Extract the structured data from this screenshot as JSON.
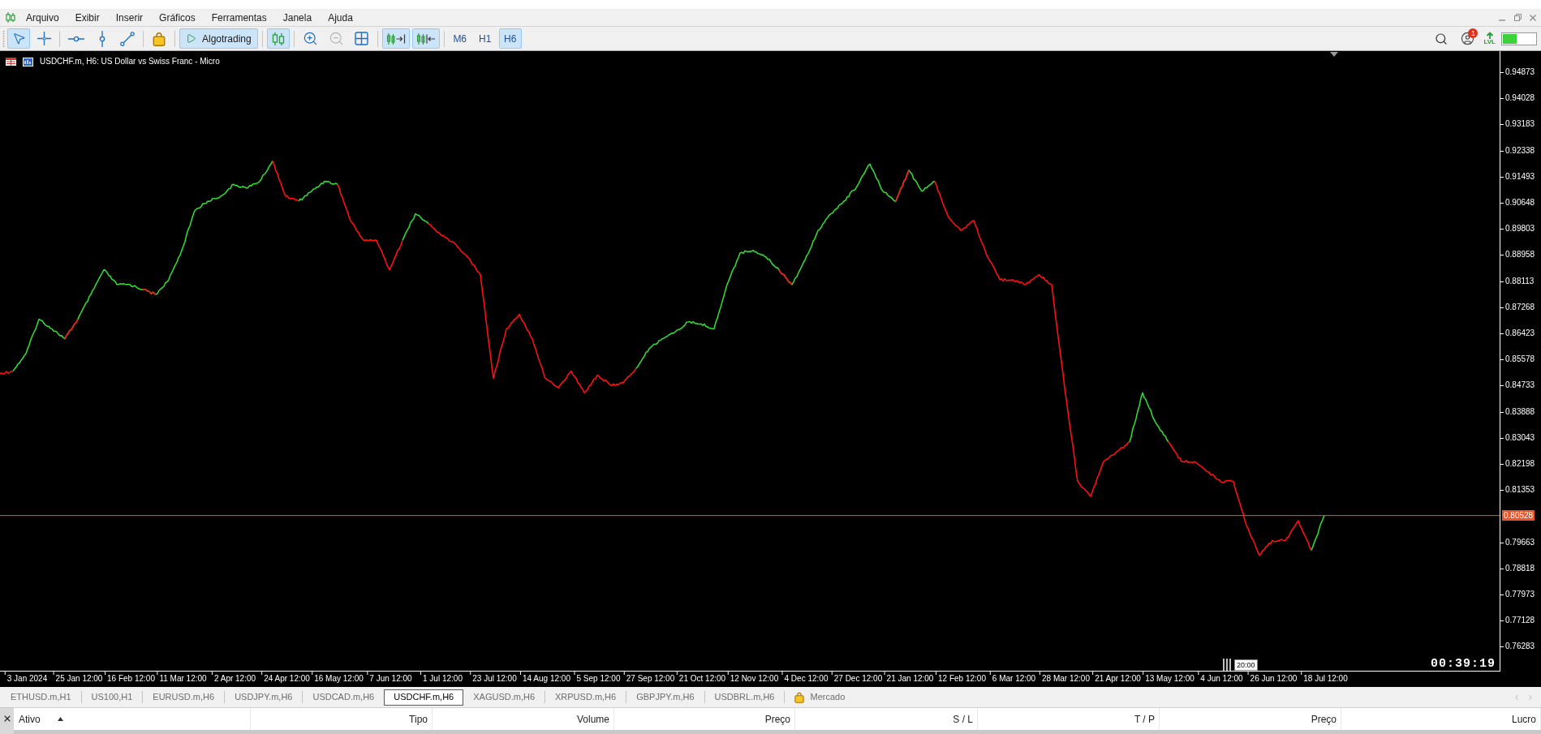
{
  "menu_bar": {
    "items": [
      "Arquivo",
      "Exibir",
      "Inserir",
      "Gráficos",
      "Ferramentas",
      "Janela",
      "Ajuda"
    ]
  },
  "toolbar": {
    "groups": [
      {
        "buttons": [
          {
            "kind": "cursor",
            "selected": true,
            "disabled": false
          },
          {
            "kind": "crosshair",
            "selected": false,
            "disabled": false
          }
        ]
      },
      {
        "buttons": [
          {
            "kind": "hline",
            "selected": false,
            "disabled": false
          },
          {
            "kind": "vline",
            "selected": false,
            "disabled": false
          },
          {
            "kind": "trendline",
            "selected": false,
            "disabled": false
          }
        ]
      },
      {
        "buttons": [
          {
            "kind": "market",
            "selected": false,
            "disabled": false
          }
        ]
      },
      {
        "buttons": [
          {
            "kind": "algotrading",
            "label": "Algotrading",
            "selected": true,
            "disabled": false
          }
        ]
      },
      {
        "buttons": [
          {
            "kind": "candles",
            "selected": true,
            "disabled": false
          }
        ]
      },
      {
        "buttons": [
          {
            "kind": "zoom_in",
            "selected": false,
            "disabled": false
          },
          {
            "kind": "zoom_out",
            "selected": false,
            "disabled": true
          },
          {
            "kind": "tile",
            "selected": false,
            "disabled": false
          }
        ]
      },
      {
        "buttons": [
          {
            "kind": "autoscroll",
            "selected": true,
            "disabled": false
          },
          {
            "kind": "shift",
            "selected": true,
            "disabled": false
          }
        ]
      },
      {
        "buttons": [
          {
            "kind": "timeframe",
            "label": "M6",
            "selected": false,
            "disabled": false
          },
          {
            "kind": "timeframe",
            "label": "H1",
            "selected": false,
            "disabled": false
          },
          {
            "kind": "timeframe",
            "label": "H6",
            "selected": true,
            "disabled": false
          }
        ]
      }
    ]
  },
  "status_icons": {
    "notification_count": "1",
    "level_label": "LVL"
  },
  "chart": {
    "title": "USDCHF.m, H6: US Dollar vs Swiss Franc - Micro",
    "timer": "00:39:19",
    "time_marker": "20:00",
    "chart_data": {
      "type": "line",
      "categories": [
        null,
        null,
        "3 Jan 2024",
        null,
        null,
        null,
        "25 Jan 12:00",
        null,
        null,
        null,
        "16 Feb 12:00",
        null,
        null,
        null,
        "11 Mar 12:00",
        null,
        null,
        null,
        "2 Apr 12:00",
        null,
        null,
        null,
        "24 Apr 12:00",
        null,
        null,
        null,
        "16 May 12:00",
        null,
        null,
        null,
        "7 Jun 12:00",
        null,
        null,
        null,
        "1 Jul 12:00",
        null,
        null,
        null,
        "23 Jul 12:00",
        null,
        null,
        null,
        "14 Aug 12:00",
        null,
        null,
        null,
        "5 Sep 12:00",
        null,
        null,
        null,
        "27 Sep 12:00",
        null,
        null,
        null,
        "21 Oct 12:00",
        null,
        null,
        null,
        "12 Nov 12:00",
        null,
        null,
        null,
        "4 Dec 12:00",
        null,
        null,
        null,
        "27 Dec 12:00",
        null,
        null,
        null,
        "21 Jan 12:00",
        null,
        null,
        null,
        "12 Feb 12:00",
        null,
        null,
        null,
        "6 Mar 12:00",
        null,
        null,
        null,
        "28 Mar 12:00",
        null,
        null,
        null,
        "21 Apr 12:00",
        null,
        null,
        null,
        "13 May 12:00",
        null,
        null,
        null,
        "4 Jun 12:00",
        null,
        null,
        null,
        "26 Jun 12:00",
        null,
        null,
        null,
        "18 Jul 12:00",
        null,
        null,
        null,
        null,
        null,
        null,
        null,
        null,
        null,
        null,
        null,
        null,
        null
      ],
      "series": [
        {
          "color": "#33d633",
          "values": [
            null,
            0.852,
            0.8577,
            0.8688,
            0.8657,
            0.8625,
            0.8688,
            0.8768,
            0.8848,
            0.88,
            0.88,
            0.8784,
            0.8768,
            0.8816,
            0.8911,
            0.9039,
            0.907,
            0.9086,
            0.9124,
            0.9112,
            0.9134,
            0.92,
            null,
            0.907,
            0.9102,
            0.9134,
            0.9124,
            null,
            null,
            null,
            null,
            0.8943,
            0.9029,
            0.8997,
            null,
            null,
            null,
            null,
            null,
            null,
            null,
            null,
            null,
            null,
            null,
            null,
            null,
            null,
            null,
            0.8529,
            0.8593,
            0.8625,
            0.8647,
            0.8679,
            0.8673,
            0.8657,
            0.88,
            0.8902,
            0.8911,
            0.8889,
            0.8848,
            0.88,
            0.8879,
            0.8975,
            0.9029,
            0.907,
            0.9118,
            0.919,
            0.9102,
            0.907,
            0.917,
            0.9102,
            0.9134,
            null,
            null,
            null,
            null,
            null,
            null,
            null,
            null,
            null,
            null,
            null,
            null,
            null,
            null,
            0.8291,
            0.845,
            0.8354,
            0.8291,
            null,
            null,
            null,
            null,
            null,
            null,
            null,
            null,
            null,
            null,
            0.794,
            0.8053,
            null,
            null,
            null,
            null,
            null,
            null,
            null,
            null,
            null,
            null,
            null,
            null,
            null
          ]
        },
        {
          "color": "#ff1010",
          "values": [
            0.8513,
            0.852,
            null,
            null,
            null,
            0.8625,
            0.8688,
            null,
            null,
            null,
            null,
            0.8784,
            0.8768,
            null,
            null,
            null,
            null,
            null,
            null,
            null,
            null,
            0.92,
            0.9086,
            0.907,
            null,
            null,
            0.9124,
            0.9007,
            0.8943,
            0.8943,
            0.8848,
            0.8943,
            null,
            0.8997,
            0.8959,
            0.8934,
            0.8889,
            0.8832,
            0.8497,
            0.8657,
            0.8704,
            0.8625,
            0.8497,
            0.8466,
            0.852,
            0.845,
            0.8507,
            0.8475,
            0.8482,
            0.8529,
            null,
            null,
            null,
            null,
            null,
            null,
            null,
            null,
            null,
            null,
            0.8848,
            0.88,
            null,
            null,
            null,
            null,
            null,
            null,
            null,
            0.907,
            0.917,
            null,
            0.9134,
            0.9023,
            0.8975,
            0.9007,
            0.8895,
            0.8816,
            0.8816,
            0.88,
            0.8832,
            0.88,
            0.8466,
            0.8163,
            0.8115,
            0.8227,
            0.8259,
            0.8291,
            null,
            null,
            0.8291,
            0.8227,
            0.8227,
            0.8195,
            0.8163,
            0.8163,
            0.802,
            0.7924,
            0.7972,
            0.7972,
            0.8036,
            0.794,
            null,
            null,
            null,
            null,
            null,
            null,
            null,
            null,
            null,
            null,
            null,
            null,
            null,
            null
          ]
        }
      ],
      "ylim": [
        0.75506,
        0.95555
      ],
      "yticks": [
        {
          "value": 0.94873,
          "label": "0.94873"
        },
        {
          "value": 0.94028,
          "label": "0.94028"
        },
        {
          "value": 0.93183,
          "label": "0.93183"
        },
        {
          "value": 0.92338,
          "label": "0.92338"
        },
        {
          "value": 0.91493,
          "label": "0.91493"
        },
        {
          "value": 0.90648,
          "label": "0.90648"
        },
        {
          "value": 0.89803,
          "label": "0.89803"
        },
        {
          "value": 0.88958,
          "label": "0.88958"
        },
        {
          "value": 0.88113,
          "label": "0.88113"
        },
        {
          "value": 0.87268,
          "label": "0.87268"
        },
        {
          "value": 0.86423,
          "label": "0.86423"
        },
        {
          "value": 0.85578,
          "label": "0.85578"
        },
        {
          "value": 0.84733,
          "label": "0.84733"
        },
        {
          "value": 0.83888,
          "label": "0.83888"
        },
        {
          "value": 0.83043,
          "label": "0.83043"
        },
        {
          "value": 0.82198,
          "label": "0.82198"
        },
        {
          "value": 0.81353,
          "label": "0.81353"
        },
        {
          "value": 0.79663,
          "label": "0.79663"
        },
        {
          "value": 0.78818,
          "label": "0.78818"
        },
        {
          "value": 0.77973,
          "label": "0.77973"
        },
        {
          "value": 0.77128,
          "label": "0.77128"
        },
        {
          "value": 0.76283,
          "label": "0.76283"
        }
      ],
      "ref_lines": [
        {
          "axis": "y",
          "value": 0.80528,
          "label": "0.80528",
          "color": "#e8552a"
        }
      ]
    }
  },
  "symbol_tabs": [
    {
      "label": "ETHUSD.m,H1",
      "selected": false
    },
    {
      "label": "US100,H1",
      "selected": false
    },
    {
      "label": "EURUSD.m,H6",
      "selected": false
    },
    {
      "label": "USDJPY.m,H6",
      "selected": false
    },
    {
      "label": "USDCAD.m,H6",
      "selected": false
    },
    {
      "label": "USDCHF.m,H6",
      "selected": true
    },
    {
      "label": "XAGUSD.m,H6",
      "selected": false
    },
    {
      "label": "XRPUSD.m,H6",
      "selected": false
    },
    {
      "label": "GBPJPY.m,H6",
      "selected": false
    },
    {
      "label": "USDBRL.m,H6",
      "selected": false
    }
  ],
  "market_button": "Mercado",
  "positions_table": {
    "columns": [
      {
        "label": "Ativo",
        "sorted": true
      },
      {
        "label": "Tipo",
        "sorted": false
      },
      {
        "label": "Volume",
        "sorted": false
      },
      {
        "label": "Preço",
        "sorted": false
      },
      {
        "label": "S / L",
        "sorted": false
      },
      {
        "label": "T / P",
        "sorted": false
      },
      {
        "label": "Preço",
        "sorted": false
      },
      {
        "label": "Lucro",
        "sorted": false
      }
    ]
  }
}
